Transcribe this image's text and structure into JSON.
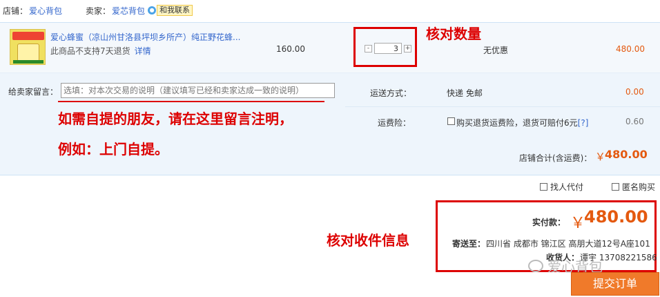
{
  "store": {
    "store_label": "店铺：",
    "store_name": "爱心背包",
    "seller_label": "卖家：",
    "seller_name": "爱芯背包",
    "contact_label": "和我联系"
  },
  "item": {
    "title": "爱心蜂蜜（凉山州甘洛县坪坝乡所产）纯正野花蜂...",
    "note": "此商品不支持7天退货",
    "detail_link": "详情",
    "price": "160.00",
    "quantity": "3",
    "minus": "-",
    "plus": "+",
    "discount": "无优惠",
    "subtotal": "480.00"
  },
  "options": {
    "message_label": "给卖家留言：",
    "message_placeholder": "选填：对本次交易的说明（建议填写已经和卖家达成一致的说明）",
    "shipping_label": "运送方式：",
    "shipping_value": "快递 免邮",
    "shipping_fee": "0.00",
    "insurance_label": "运费险：",
    "insurance_text": "购买退货运费险，退货可赔付6元",
    "insurance_help": "[?]",
    "insurance_fee": "0.60",
    "total_label": "店铺合计(含运费)：",
    "total_yen": "￥",
    "total_value": "480.00"
  },
  "extras": {
    "proxy_pay": "找人代付",
    "anonymous": "匿名购买"
  },
  "payment": {
    "label": "实付款：",
    "yen": "￥",
    "amount": "480.00",
    "address_label": "寄送至：",
    "address": "四川省 成都市 锦江区 高朋大道12号A座101",
    "receiver_label": "收货人：",
    "receiver": "谭宇 13708221586",
    "submit": "提交订单"
  },
  "annotations": {
    "check_quantity": "核对数量",
    "note_line1": "如需自提的朋友，请在这里留言注明，",
    "note_line2": "例如：上门自提。",
    "check_receiver": "核对收件信息"
  },
  "watermark": "爱心背包",
  "colors": {
    "link": "#3366cc",
    "price_orange": "#e4590f",
    "annotation_red": "#dd0000",
    "submit_bg": "#f07a2a",
    "panel_bg": "#eef5fc"
  }
}
